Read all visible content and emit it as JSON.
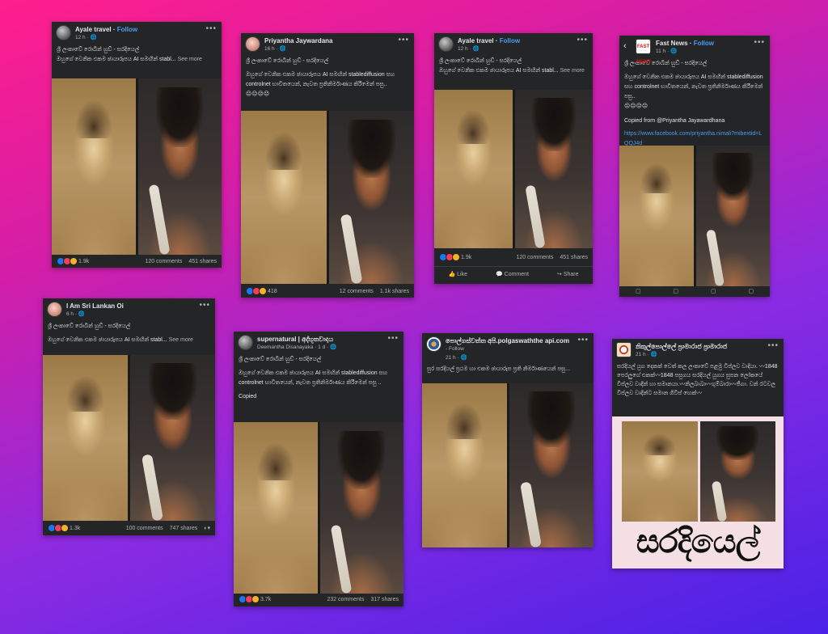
{
  "posts": [
    {
      "name": "Ayale travel",
      "follow": "Follow",
      "meta": "12 h ·",
      "line1": "ශ්‍රී ලංකාවේ රොබින් හුඩ් - සරදියෙල්",
      "line2": "ඔහුගේ වෙනික එකම ඡායාරූපය   AI සමඟින් stabl...",
      "more": "See more",
      "reactions": "1.9k",
      "comments": "120 comments",
      "shares": "451 shares"
    },
    {
      "name": "Priyantha Jaywardana",
      "meta": "16 h ·",
      "line1": "ශ්‍රී ලංකාවේ රොබින් හුඩ් - සරදියෙල්",
      "line2": "ඔහුගේ වෙනික එකම ඡායාරූපය   AI සමඟින් stablediffusion සහ controlnet භාවිතයෙන්, නැවත ප්‍රතිනිර්මාණය කිරීමෙන් පසු..",
      "emoji": "😐😐😐😐",
      "reactions": "418",
      "comments": "12 comments",
      "shares": "1.1k shares"
    },
    {
      "name": "Ayale travel",
      "follow": "Follow",
      "meta": "12 h ·",
      "line1": "ශ්‍රී ලංකාවේ රොබින් හුඩ් - සරදියෙල්",
      "line2": "ඔහුගේ වෙනික එකම ඡායාරූපය   AI සමඟින් stabl...",
      "more": "See more",
      "reactions": "1.9k",
      "comments": "120 comments",
      "shares": "451 shares",
      "like": "Like",
      "comment": "Comment",
      "share": "Share"
    },
    {
      "name": "Fast News",
      "follow": "Follow",
      "meta": "11 h ·",
      "logo": "FAST NEWS",
      "line1": "ශ්‍රී ලංකාවේ රොබින් හුඩ් - සරදියෙල්",
      "line2": "ඔහුගේ වෙනික එකම ඡායාරූපය   AI සමඟින් stablediffusion සහ controlnet භාවිතයෙන්, නැවත ප්‍රතිනිර්මාණය කිරීමෙන් පසු..",
      "emoji": "😐😐😐😐",
      "copied": "Copied from @Priyantha Jayawardhana",
      "link": "https://www.facebook.com/priyantha.nimali?mibextid=LQQJ4d"
    },
    {
      "name": "I Am  Sri Lankan Oi",
      "meta": "6 h ·",
      "line1": "ශ්‍රී ලංකාවේ රොබින් හුඩ් - සරදියෙල්",
      "line2": "ඔහුගේ වෙනික එකම ඡායාරූපය   AI සමඟින් stabl...",
      "more": "See more",
      "reactions": "1.3k",
      "comments": "100 comments",
      "shares": "747 shares"
    },
    {
      "name": "supernatural | අද්භූතවාදය",
      "sub": "Deemantha Disanayaka · 1 d ·",
      "line1": "ශ්‍රී ලංකාවේ රොබින් හුඩ් - සරදියෙල්",
      "line2": "ඔහුගේ වෙනික එකම ඡායාරූපය   AI සමඟින් stablediffusion සහ controlnet භාවිතයෙන්, නැවත ප්‍රතිනිර්මාණය කිරීමෙන් පසු ..",
      "copied": "Copied",
      "reactions": "3.7k",
      "comments": "232 comments",
      "shares": "317 shares"
    },
    {
      "name": "පොල්ගස්වත්ත අපි.polgaswaththe api.com",
      "follow": "Follow",
      "meta": "21 h ·",
      "line1": "සුර සරදියල් ප්‍රථම හා එකම ඡායාරූප ප්‍රති නිර්මාණයෙන් පසු..."
    },
    {
      "name": "නිකුල්පොල්ලේ ප්‍රාමාරාජ ප්‍රාමාරාජ",
      "meta": "21 h ·",
      "line1": "සරදියල් යුග දෙකක් වෙත් කල ලංකාවේ පළමු විප්ලව වාදියා. 〰1848 පෙරලුගේ එකක්〰1848 පසුගය සරදියල් යුගය සුපන ලෝකයේ විප්ලව වාදීන් හා සමානයා.〰නිලබාබා〰ගුම්බාරා〰ජීගා. වන් රටවල විප්ලව වාදීන්ට සමාන ගිවිස් හෙක්〰",
      "big": "සරදියෙල්"
    }
  ]
}
